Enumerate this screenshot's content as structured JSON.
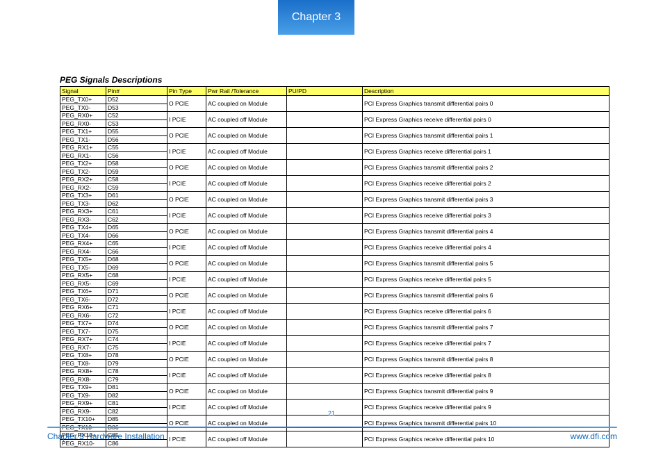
{
  "chapter_tab": "Chapter 3",
  "table_title": "PEG Signals Descriptions",
  "headers": [
    "Signal",
    "Pin#",
    "Pin Type",
    "Pwr Rail /Tolerance",
    "PU/PD",
    "Description"
  ],
  "groups": [
    {
      "rows": [
        [
          "PEG_TX0+",
          "D52"
        ],
        [
          "PEG_TX0-",
          "D53"
        ]
      ],
      "pintype": "O PCIE",
      "pwr": "AC coupled on Module",
      "pupd": "",
      "desc": "PCI Express Graphics transmit differential pairs 0"
    },
    {
      "rows": [
        [
          "PEG_RX0+",
          "C52"
        ],
        [
          "PEG_RX0-",
          "C53"
        ]
      ],
      "pintype": "I PCIE",
      "pwr": "AC coupled off Module",
      "pupd": "",
      "desc": "PCI Express Graphics receive differential pairs 0"
    },
    {
      "rows": [
        [
          "PEG_TX1+",
          "D55"
        ],
        [
          "PEG_TX1-",
          "D56"
        ]
      ],
      "pintype": "O PCIE",
      "pwr": "AC coupled on Module",
      "pupd": "",
      "desc": "PCI Express Graphics transmit differential pairs 1"
    },
    {
      "rows": [
        [
          "PEG_RX1+",
          "C55"
        ],
        [
          "PEG_RX1-",
          "C56"
        ]
      ],
      "pintype": "I PCIE",
      "pwr": "AC coupled off Module",
      "pupd": "",
      "desc": "PCI Express Graphics receive differential pairs 1"
    },
    {
      "rows": [
        [
          "PEG_TX2+",
          "D58"
        ],
        [
          "PEG_TX2-",
          "D59"
        ]
      ],
      "pintype": "O PCIE",
      "pwr": "AC coupled on Module",
      "pupd": "",
      "desc": "PCI Express Graphics transmit differential pairs 2"
    },
    {
      "rows": [
        [
          "PEG_RX2+",
          "C58"
        ],
        [
          "PEG_RX2-",
          "C59"
        ]
      ],
      "pintype": "I PCIE",
      "pwr": "AC coupled off Module",
      "pupd": "",
      "desc": "PCI Express Graphics receive differential pairs 2"
    },
    {
      "rows": [
        [
          "PEG_TX3+",
          "D61"
        ],
        [
          "PEG_TX3-",
          "D62"
        ]
      ],
      "pintype": "O PCIE",
      "pwr": "AC coupled on Module",
      "pupd": "",
      "desc": "PCI Express Graphics transmit differential pairs 3"
    },
    {
      "rows": [
        [
          "PEG_RX3+",
          "C61"
        ],
        [
          "PEG_RX3-",
          "C62"
        ]
      ],
      "pintype": "I PCIE",
      "pwr": "AC coupled off Module",
      "pupd": "",
      "desc": "PCI Express Graphics receive differential pairs 3"
    },
    {
      "rows": [
        [
          "PEG_TX4+",
          "D65"
        ],
        [
          "PEG_TX4-",
          "D66"
        ]
      ],
      "pintype": "O PCIE",
      "pwr": "AC coupled on Module",
      "pupd": "",
      "desc": "PCI Express Graphics transmit differential pairs 4"
    },
    {
      "rows": [
        [
          "PEG_RX4+",
          "C65"
        ],
        [
          "PEG_RX4-",
          "C66"
        ]
      ],
      "pintype": "I PCIE",
      "pwr": "AC coupled off Module",
      "pupd": "",
      "desc": "PCI Express Graphics receive differential pairs 4"
    },
    {
      "rows": [
        [
          "PEG_TX5+",
          "D68"
        ],
        [
          "PEG_TX5-",
          "D69"
        ]
      ],
      "pintype": "O PCIE",
      "pwr": "AC coupled on Module",
      "pupd": "",
      "desc": "PCI Express Graphics transmit differential pairs 5"
    },
    {
      "rows": [
        [
          "PEG_RX5+",
          "C68"
        ],
        [
          "PEG_RX5-",
          "C69"
        ]
      ],
      "pintype": "I PCIE",
      "pwr": "AC coupled off Module",
      "pupd": "",
      "desc": "PCI Express Graphics receive differential pairs 5"
    },
    {
      "rows": [
        [
          "PEG_TX6+",
          "D71"
        ],
        [
          "PEG_TX6-",
          "D72"
        ]
      ],
      "pintype": "O PCIE",
      "pwr": "AC coupled on Module",
      "pupd": "",
      "desc": "PCI Express Graphics transmit differential pairs 6"
    },
    {
      "rows": [
        [
          "PEG_RX6+",
          "C71"
        ],
        [
          "PEG_RX6-",
          "C72"
        ]
      ],
      "pintype": "I PCIE",
      "pwr": "AC coupled off Module",
      "pupd": "",
      "desc": "PCI Express Graphics receive differential pairs 6"
    },
    {
      "rows": [
        [
          "PEG_TX7+",
          "D74"
        ],
        [
          "PEG_TX7-",
          "D75"
        ]
      ],
      "pintype": "O PCIE",
      "pwr": "AC coupled on Module",
      "pupd": "",
      "desc": "PCI Express Graphics transmit differential pairs 7"
    },
    {
      "rows": [
        [
          "PEG_RX7+",
          "C74"
        ],
        [
          "PEG_RX7-",
          "C75"
        ]
      ],
      "pintype": "I PCIE",
      "pwr": "AC coupled off Module",
      "pupd": "",
      "desc": "PCI Express Graphics receive differential pairs 7"
    },
    {
      "rows": [
        [
          "PEG_TX8+",
          "D78"
        ],
        [
          "PEG_TX8-",
          "D79"
        ]
      ],
      "pintype": "O PCIE",
      "pwr": "AC coupled on Module",
      "pupd": "",
      "desc": "PCI Express Graphics transmit differential pairs 8"
    },
    {
      "rows": [
        [
          "PEG_RX8+",
          "C78"
        ],
        [
          "PEG_RX8-",
          "C79"
        ]
      ],
      "pintype": "I PCIE",
      "pwr": "AC coupled off Module",
      "pupd": "",
      "desc": "PCI Express Graphics receive differential pairs 8"
    },
    {
      "rows": [
        [
          "PEG_TX9+",
          "D81"
        ],
        [
          "PEG_TX9-",
          "D82"
        ]
      ],
      "pintype": "O PCIE",
      "pwr": "AC coupled on Module",
      "pupd": "",
      "desc": "PCI Express Graphics transmit differential pairs 9"
    },
    {
      "rows": [
        [
          "PEG_RX9+",
          "C81"
        ],
        [
          "PEG_RX9-",
          "C82"
        ]
      ],
      "pintype": "I PCIE",
      "pwr": "AC coupled off Module",
      "pupd": "",
      "desc": "PCI Express Graphics receive differential pairs 9"
    },
    {
      "rows": [
        [
          "PEG_TX10+",
          "D85"
        ],
        [
          "PEG_TX10-",
          "D86"
        ]
      ],
      "pintype": "O PCIE",
      "pwr": "AC coupled on Module",
      "pupd": "",
      "desc": "PCI Express Graphics transmit differential pairs 10"
    },
    {
      "rows": [
        [
          "PEG_RX10+",
          "C85"
        ],
        [
          "PEG_RX10-",
          "C86"
        ]
      ],
      "pintype": "I PCIE",
      "pwr": "AC coupled off Module",
      "pupd": "",
      "desc": "PCI Express Graphics receive differential pairs 10"
    }
  ],
  "page_number": "21",
  "footer_left": "Chapter 3 Hardware Installation",
  "footer_right": "www.dfi.com"
}
